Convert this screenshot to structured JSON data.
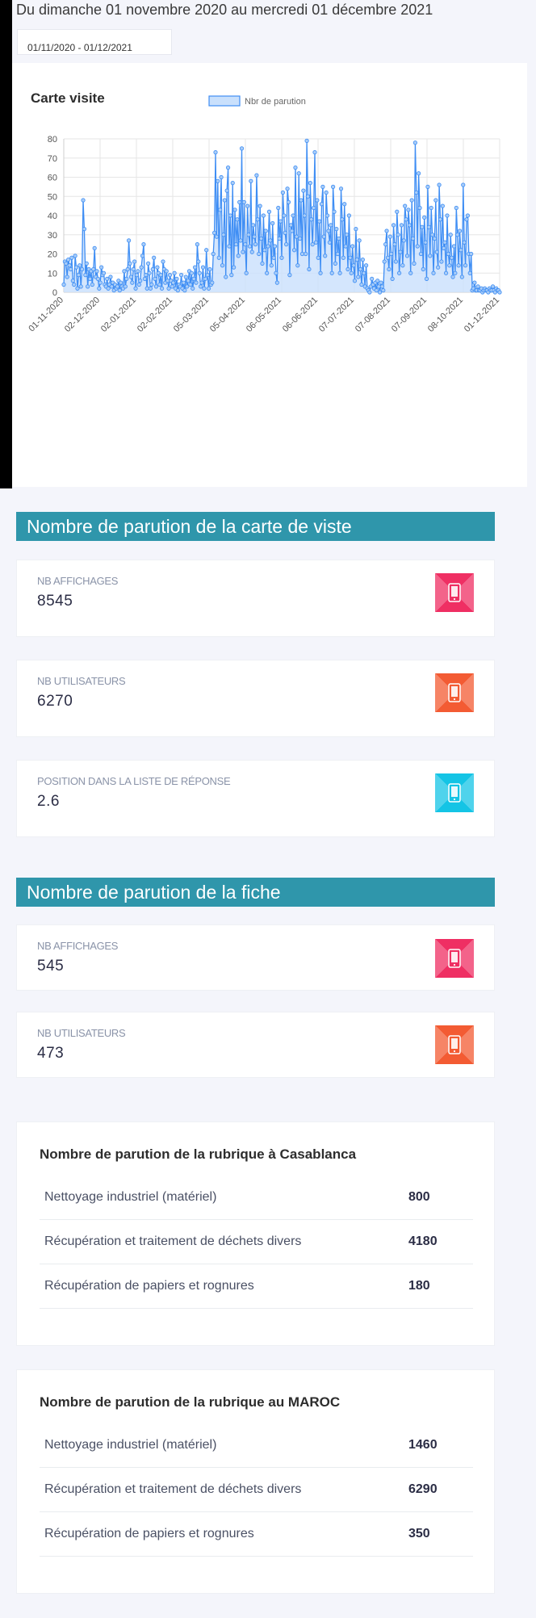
{
  "period": "Du dimanche 01 novembre 2020 au mercredi 01 décembre 2021",
  "date_range_value": "01/11/2020 - 01/12/2021",
  "colors": {
    "section_header": "#2f96ab",
    "pink": "#ef2f63",
    "orange": "#f35b33",
    "cyan": "#14c4e5",
    "line": "#3f8ef4",
    "fill": "#c9e0fc"
  },
  "chart_card_title": "Carte visite",
  "chart_data": {
    "type": "area",
    "title": "",
    "legend": [
      "Nbr de parution"
    ],
    "legend_position": "top",
    "grid": true,
    "ylim": [
      0,
      80
    ],
    "yticks": [
      0,
      10,
      20,
      30,
      40,
      50,
      60,
      70,
      80
    ],
    "xtick_labels": [
      "01-11-2020",
      "02-12-2020",
      "02-01-2021",
      "02-02-2021",
      "05-03-2021",
      "05-04-2021",
      "06-05-2021",
      "06-06-2021",
      "07-07-2021",
      "07-08-2021",
      "07-09-2021",
      "08-10-2021",
      "01-12-2021"
    ],
    "series": [
      {
        "name": "Nbr de parution",
        "values": [
          4,
          16,
          15,
          8,
          17,
          14,
          12,
          18,
          6,
          4,
          19,
          13,
          2,
          9,
          14,
          3,
          12,
          48,
          33,
          9,
          15,
          3,
          12,
          7,
          11,
          4,
          12,
          23,
          8,
          11,
          7,
          2,
          5,
          13,
          9,
          10,
          4,
          3,
          7,
          2,
          4,
          8,
          3,
          5,
          1,
          4,
          2,
          3,
          6,
          1,
          5,
          3,
          2,
          11,
          3,
          7,
          12,
          27,
          15,
          8,
          5,
          12,
          16,
          2,
          9,
          11,
          4,
          6,
          13,
          19,
          25,
          7,
          9,
          2,
          15,
          10,
          2,
          4,
          12,
          18,
          7,
          3,
          13,
          10,
          4,
          9,
          2,
          16,
          12,
          5,
          11,
          6,
          2,
          9,
          6,
          3,
          5,
          10,
          2,
          7,
          1,
          4,
          3,
          9,
          2,
          5,
          1,
          8,
          3,
          6,
          11,
          4,
          10,
          2,
          7,
          13,
          5,
          25,
          16,
          10,
          3,
          5,
          13,
          2,
          7,
          22,
          9,
          2,
          12,
          4,
          5,
          20,
          31,
          73,
          29,
          58,
          18,
          43,
          60,
          14,
          30,
          48,
          8,
          53,
          65,
          24,
          40,
          9,
          57,
          13,
          43,
          25,
          38,
          19,
          47,
          27,
          75,
          21,
          47,
          25,
          10,
          45,
          30,
          24,
          58,
          21,
          35,
          29,
          25,
          61,
          38,
          20,
          45,
          28,
          15,
          40,
          22,
          32,
          10,
          24,
          42,
          27,
          14,
          36,
          18,
          24,
          10,
          5,
          44,
          28,
          37,
          18,
          52,
          40,
          31,
          25,
          54,
          47,
          9,
          35,
          32,
          40,
          22,
          65,
          29,
          14,
          62,
          28,
          48,
          20,
          53,
          40,
          20,
          79,
          50,
          12,
          57,
          38,
          25,
          44,
          73,
          26,
          48,
          18,
          37,
          10,
          46,
          55,
          29,
          19,
          52,
          40,
          32,
          26,
          35,
          10,
          55,
          42,
          15,
          33,
          20,
          28,
          10,
          54,
          38,
          18,
          46,
          24,
          30,
          12,
          40,
          18,
          10,
          24,
          14,
          6,
          33,
          17,
          8,
          27,
          12,
          4,
          17,
          10,
          3,
          14,
          2,
          1,
          0,
          3,
          7,
          4,
          2,
          5,
          1,
          6,
          3,
          0,
          5,
          3,
          1,
          16,
          25,
          32,
          18,
          12,
          29,
          20,
          7,
          35,
          25,
          16,
          42,
          30,
          10,
          21,
          35,
          14,
          27,
          45,
          38,
          19,
          43,
          35,
          10,
          48,
          28,
          15,
          78,
          52,
          24,
          62,
          44,
          20,
          34,
          12,
          39,
          26,
          7,
          55,
          34,
          19,
          44,
          30,
          10,
          28,
          48,
          21,
          13,
          56,
          38,
          16,
          45,
          23,
          26,
          10,
          40,
          20,
          14,
          30,
          18,
          8,
          24,
          10,
          44,
          30,
          14,
          32,
          22,
          8,
          56,
          26,
          14,
          38,
          40,
          20,
          10,
          20,
          1,
          2,
          5,
          1,
          1,
          3,
          1,
          1,
          2,
          0,
          1,
          2,
          1,
          1,
          0,
          2,
          1,
          1,
          3,
          1,
          0,
          2,
          1,
          1,
          0
        ]
      }
    ]
  },
  "section1": {
    "title": "Nombre de parution de la carte de viste",
    "cards": [
      {
        "label": "Nb affichages",
        "value": "8545",
        "icon": "pink"
      },
      {
        "label": "Nb utilisateurs",
        "value": "6270",
        "icon": "orange"
      },
      {
        "label": "Position dans la liste de réponse",
        "value": "2.6",
        "icon": "cyan"
      }
    ]
  },
  "section2": {
    "title": "Nombre de parution de la fiche",
    "cards": [
      {
        "label": "Nb affichages",
        "value": "545",
        "icon": "pink"
      },
      {
        "label": "Nb utilisateurs",
        "value": "473",
        "icon": "orange"
      }
    ]
  },
  "casablanca": {
    "title": "Nombre de parution de la rubrique à Casablanca",
    "rows": [
      {
        "label": "Nettoyage industriel (matériel)",
        "value": "800"
      },
      {
        "label": "Récupération et traitement de déchets divers",
        "value": "4180"
      },
      {
        "label": "Récupération de papiers et rognures",
        "value": "180"
      }
    ]
  },
  "maroc": {
    "title": "Nombre de parution de la rubrique au MAROC",
    "rows": [
      {
        "label": "Nettoyage industriel (matériel)",
        "value": "1460"
      },
      {
        "label": "Récupération et traitement de déchets divers",
        "value": "6290"
      },
      {
        "label": "Récupération de papiers et rognures",
        "value": "350"
      }
    ]
  }
}
